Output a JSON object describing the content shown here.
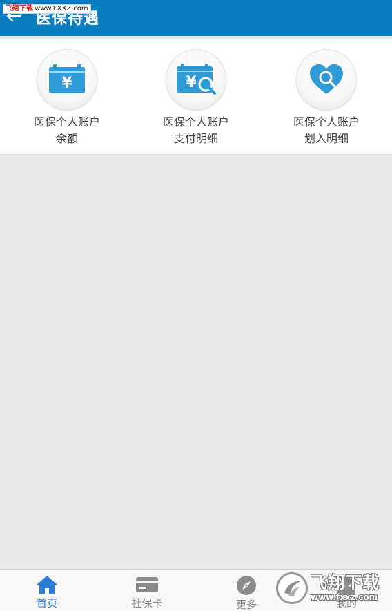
{
  "watermark_top": {
    "brand": "飞翔下载",
    "url": "www.FXXZ.com"
  },
  "header": {
    "title": "医保待遇",
    "back_icon": "back-arrow-icon"
  },
  "features": [
    {
      "label": "医保个人账户余额",
      "icon": "wallet-yuan-icon"
    },
    {
      "label": "医保个人账户支付明细",
      "icon": "wallet-yuan-search-icon"
    },
    {
      "label": "医保个人账户划入明细",
      "icon": "heart-search-icon"
    }
  ],
  "bottom_nav": [
    {
      "label": "首页",
      "icon": "home-icon",
      "active": true
    },
    {
      "label": "社保卡",
      "icon": "card-icon",
      "active": false
    },
    {
      "label": "更多",
      "icon": "compass-icon",
      "active": false
    },
    {
      "label": "我的",
      "icon": "user-icon",
      "active": false
    }
  ],
  "watermark_bottom": {
    "brand": "飞翔下载",
    "url": "www.fxxz.com"
  },
  "colors": {
    "header_bg": "#0a7dc1",
    "icon_blue": "#2f9bd6",
    "nav_active": "#2a7dd6",
    "nav_inactive": "#888888"
  }
}
